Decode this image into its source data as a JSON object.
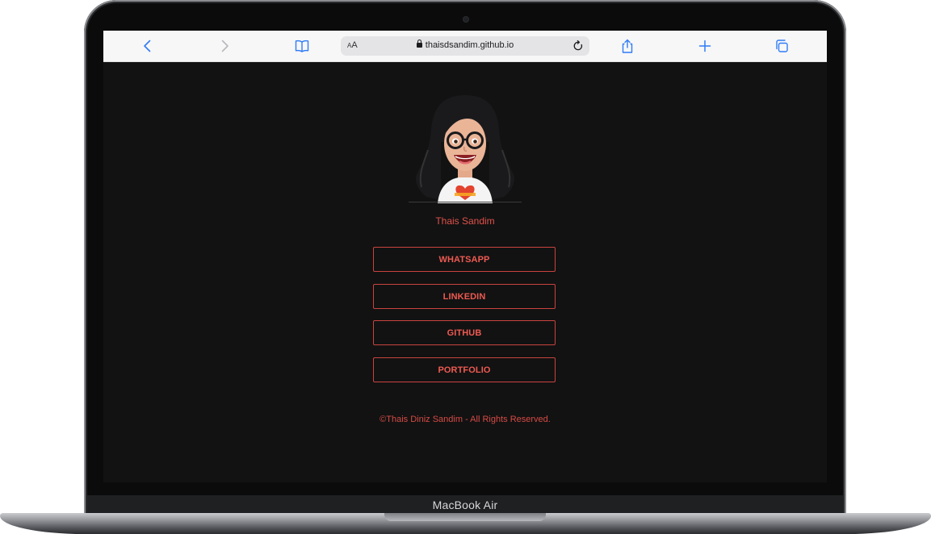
{
  "browser": {
    "url": "thaisdsandim.github.io",
    "text_size_label": "AA",
    "icons": [
      "chevron-left-icon",
      "chevron-right-icon",
      "book-icon",
      "lock-icon",
      "reload-icon",
      "share-icon",
      "plus-icon",
      "tabs-icon"
    ]
  },
  "profile": {
    "name": "Thais Sandim"
  },
  "links": [
    {
      "label": "WHATSAPP"
    },
    {
      "label": "LINKEDIN"
    },
    {
      "label": "GITHUB"
    },
    {
      "label": "PORTFOLIO"
    }
  ],
  "footer": {
    "text": "©Thais Diniz Sandim - All Rights Reserved."
  },
  "device": {
    "label": "MacBook Air"
  },
  "colors": {
    "accent": "#ee5a52",
    "page_background": "#121212",
    "toolbar_icon": "#2f7cf6"
  }
}
